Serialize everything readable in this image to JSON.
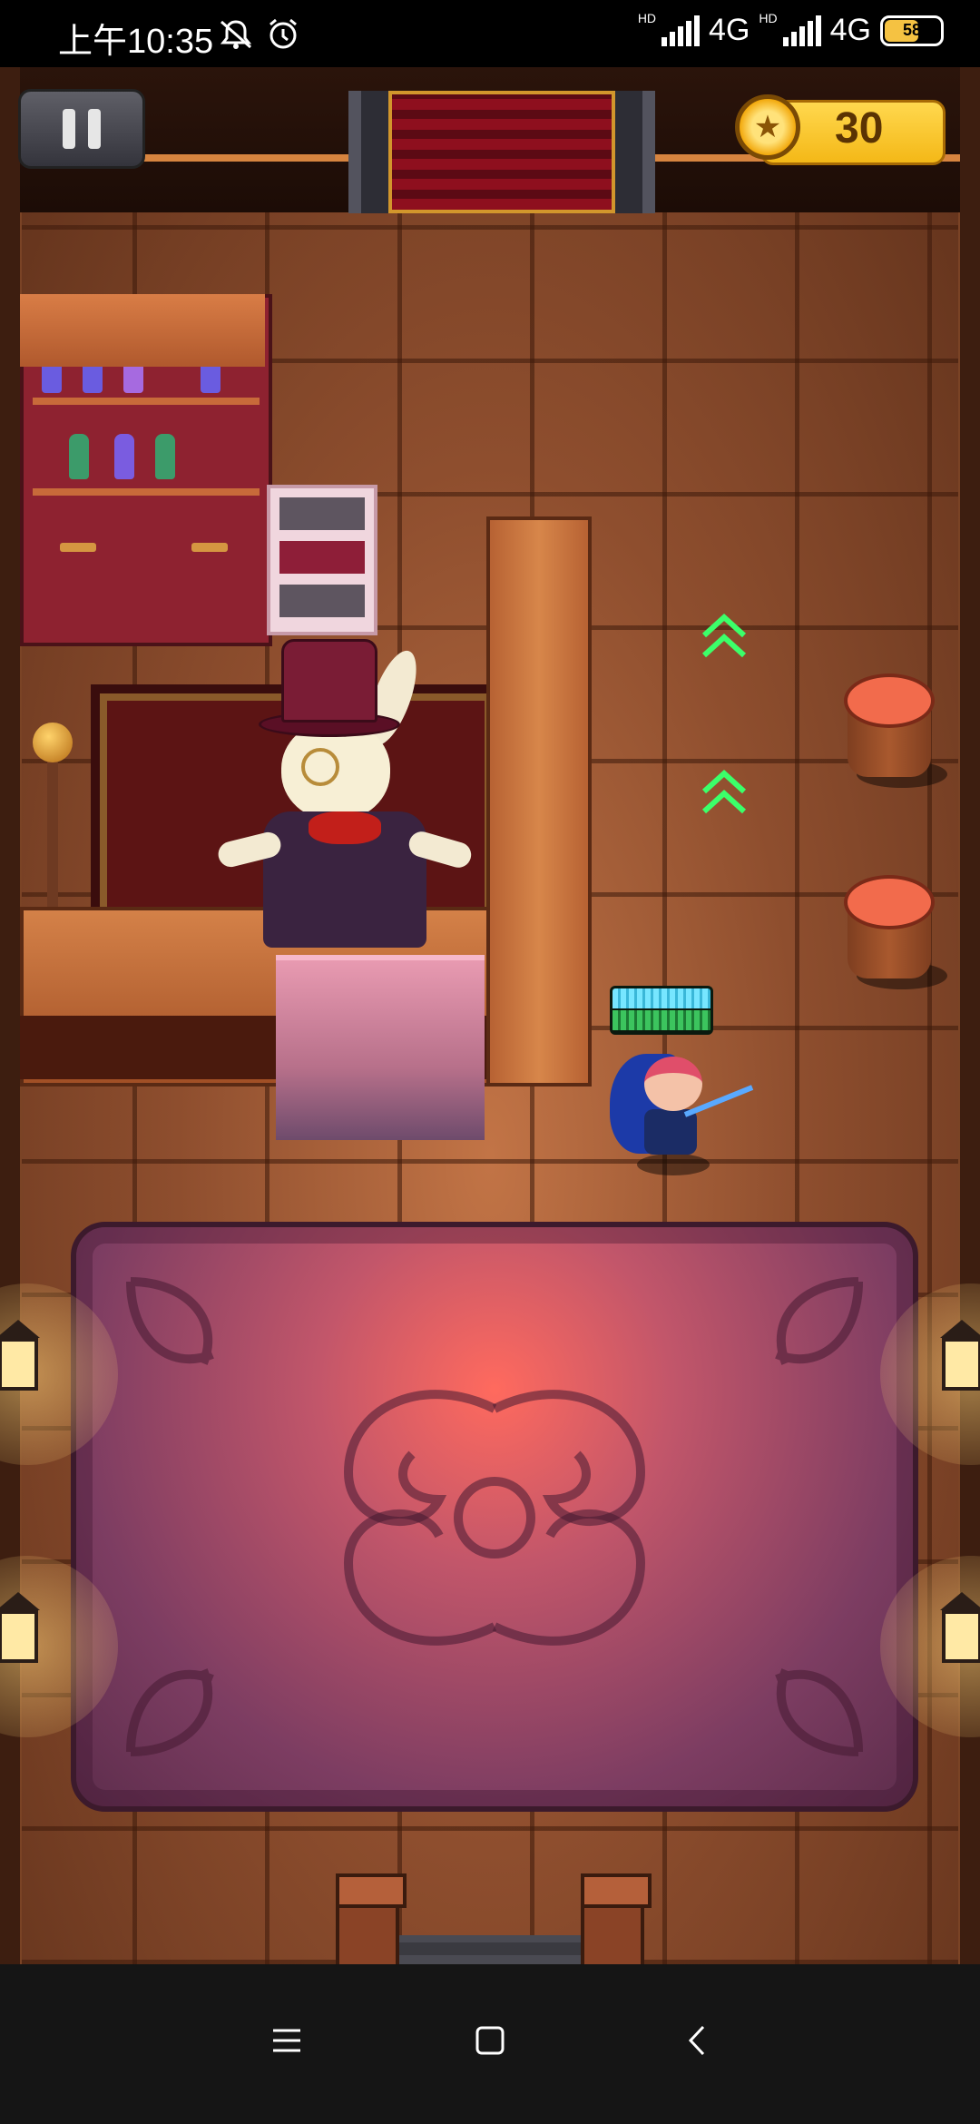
{
  "status_bar": {
    "time": "上午10:35",
    "network_1": "4G",
    "network_2": "4G",
    "hd_1": "HD",
    "hd_2": "HD",
    "battery": "58",
    "battery_level": 0.58,
    "icons": [
      "notifications-off-icon",
      "alarm-icon",
      "signal-icon",
      "signal-icon",
      "battery-icon"
    ]
  },
  "hud": {
    "coins": "30",
    "coin_icon": "star-coin-icon",
    "pause_icon": "pause-icon"
  },
  "scene": {
    "hero_hp_fraction": 1.0,
    "hero_shield_fraction": 1.0,
    "colors": {
      "accent_gold": "#f4b817",
      "arrow_green": "#3cff6a",
      "rug": "#7d3d62"
    }
  },
  "nav_bar": {
    "menu_icon": "menu-icon",
    "home_icon": "home-icon",
    "back_icon": "back-icon"
  }
}
